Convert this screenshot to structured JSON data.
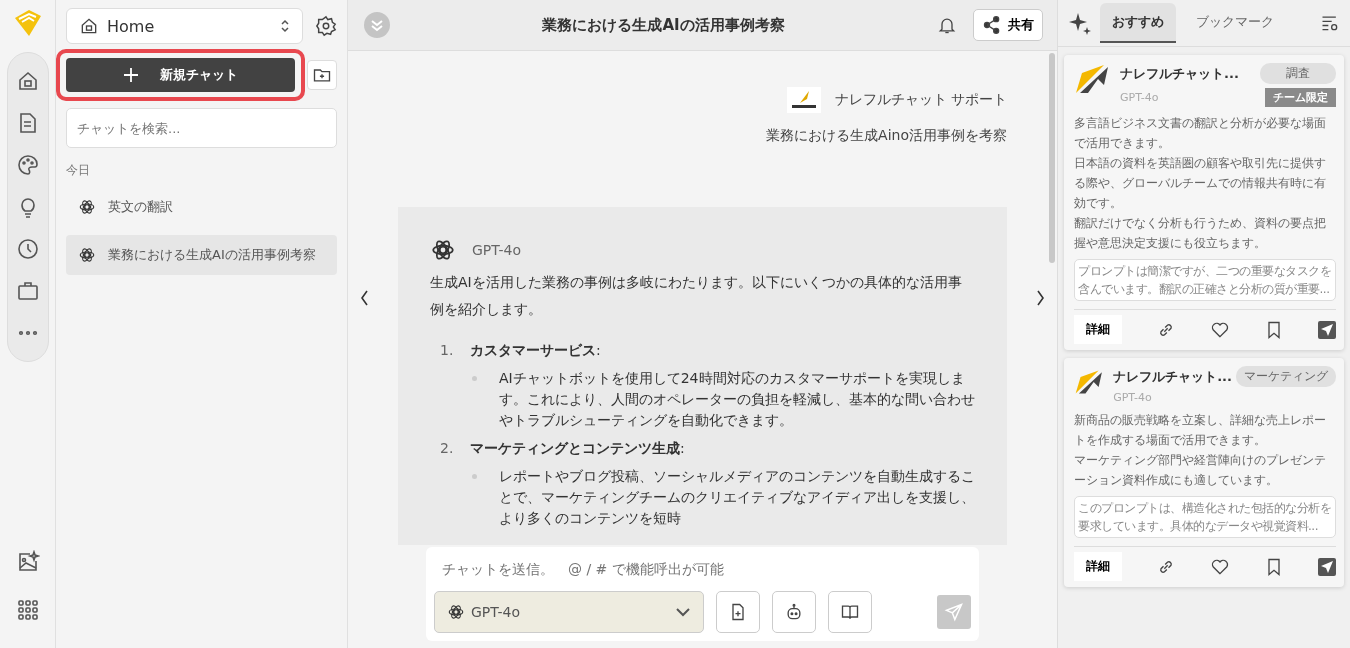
{
  "sidebar": {
    "workspace": "Home",
    "new_chat": {
      "label": "新規チャット",
      "highlighted": true
    },
    "search": {
      "placeholder": "チャットを検索..."
    },
    "section": "今日",
    "chats": [
      {
        "title": "英文の翻訳",
        "selected": false
      },
      {
        "title": "業務における生成AIの活用事例考察",
        "selected": true
      }
    ]
  },
  "header": {
    "title": "業務における生成AIの活用事例考察",
    "share": "共有"
  },
  "user_message": {
    "sender": "ナレフルチャット サポート",
    "text": "業務における生成Aino活用事例を考察"
  },
  "reply": {
    "model": "GPT-4o",
    "intro": "生成AIを活用した業務の事例は多岐にわたります。以下にいくつかの具体的な活用事例を紹介します。",
    "items": [
      {
        "number": "1.",
        "heading": "**カスタマーサービス**:",
        "bullets": [
          "AIチャットボットを使用して24時間対応のカスタマーサポートを実現します。これにより、人間のオペレーターの負担を軽減し、基本的な問い合わせやトラブルシューティングを自動化できます。"
        ]
      },
      {
        "number": "2.",
        "heading": "**マーケティングとコンテンツ生成**:",
        "bullets": [
          "レポートやブログ投稿、ソーシャルメディアのコンテンツを自動生成することで、マーケティングチームのクリエイティブなアイディア出しを支援し、より多くのコンテンツを短時"
        ]
      }
    ]
  },
  "composer": {
    "placeholder": "チャットを送信。　@ / # で機能呼出が可能",
    "model": "GPT-4o"
  },
  "panel": {
    "tabs": [
      {
        "label": "おすすめ",
        "selected": true
      },
      {
        "label": "ブックマーク",
        "selected": false
      }
    ],
    "cards": [
      {
        "title": "ナレフルチャット...",
        "model": "GPT-4o",
        "tag": "調査",
        "badge": "チーム限定",
        "description": [
          "多言語ビジネス文書の翻訳と分析が必要な場面で活用できます。",
          "日本語の資料を英語圏の顧客や取引先に提供する際や、グローバルチームでの情報共有時に有効です。",
          "翻訳だけでなく分析も行うため、資料の要点把握や意思決定支援にも役立ちます。"
        ],
        "comment": "プロンプトは簡潔ですが、二つの重要なタスクを含んでいます。翻訳の正確さと分析の質が重要...",
        "details": "詳細"
      },
      {
        "title": "ナレフルチャット...",
        "model": "GPT-4o",
        "tag": "マーケティング",
        "description": [
          "新商品の販売戦略を立案し、詳細な売上レポートを作成する場面で活用できます。",
          "マーケティング部門や経営陣向けのプレゼンテーション資料作成にも適しています。"
        ],
        "comment": "このプロンプトは、構造化された包括的な分析を要求しています。具体的なデータや視覚資料...",
        "details": "詳細"
      }
    ]
  }
}
